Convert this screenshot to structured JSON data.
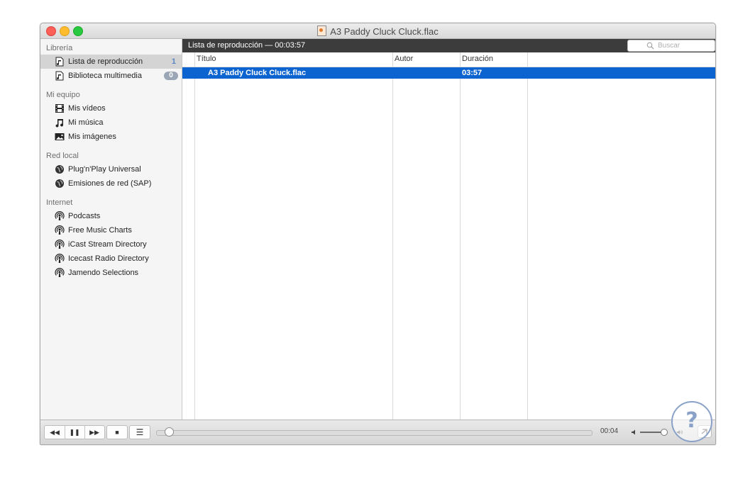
{
  "window": {
    "title": "A3 Paddy Cluck Cluck.flac",
    "file_icon": "flac-file-icon"
  },
  "sidebar": {
    "sections": [
      {
        "title": "Librería",
        "items": [
          {
            "label": "Lista de reproducción",
            "icon": "playlist-file-icon",
            "count": "1",
            "selected": true
          },
          {
            "label": "Biblioteca multimedia",
            "icon": "library-file-icon",
            "badge": "0"
          }
        ]
      },
      {
        "title": "Mi equipo",
        "items": [
          {
            "label": "Mis vídeos",
            "icon": "film-icon"
          },
          {
            "label": "Mi música",
            "icon": "music-note-icon"
          },
          {
            "label": "Mis imágenes",
            "icon": "image-icon"
          }
        ]
      },
      {
        "title": "Red local",
        "items": [
          {
            "label": "Plug'n'Play Universal",
            "icon": "network-globe-icon"
          },
          {
            "label": "Emisiones de red (SAP)",
            "icon": "network-globe-icon"
          }
        ]
      },
      {
        "title": "Internet",
        "items": [
          {
            "label": "Podcasts",
            "icon": "podcast-icon"
          },
          {
            "label": "Free Music Charts",
            "icon": "podcast-icon"
          },
          {
            "label": "iCast Stream Directory",
            "icon": "podcast-icon"
          },
          {
            "label": "Icecast Radio Directory",
            "icon": "podcast-icon"
          },
          {
            "label": "Jamendo Selections",
            "icon": "podcast-icon"
          }
        ]
      }
    ]
  },
  "playlist": {
    "header": "Lista de reproducción — 00:03:57",
    "search_placeholder": "Buscar",
    "columns": {
      "title": "Título",
      "author": "Autor",
      "duration": "Duración"
    },
    "rows": [
      {
        "title": "A3 Paddy Cluck Cluck.flac",
        "author": "",
        "duration": "03:57",
        "selected": true
      }
    ]
  },
  "controls": {
    "rewind": "◀◀",
    "pause": "❚❚",
    "forward": "▶▶",
    "stop": "■",
    "playlist_toggle": "☰",
    "elapsed": "00:04",
    "progress": 0.02,
    "volume": 0.85
  },
  "colors": {
    "selection": "#0c64d0",
    "header_bar": "#3c3c3c",
    "count_blue": "#5b87c4"
  }
}
